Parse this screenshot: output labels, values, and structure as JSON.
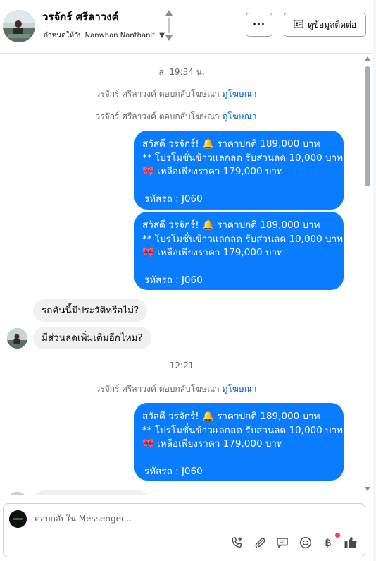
{
  "header": {
    "contact_name": "วรจักร์ ศรีลาวงค์",
    "assignment_text": "กำหนดให้กับ Nanwhan Nanthanit",
    "more_label": "···",
    "contact_info_label": "ดูข้อมูลติดต่อ"
  },
  "messages": {
    "timestamp_1": "ส. 19:34 น.",
    "timestamp_2": "12:21",
    "ad_reply_text": "วรจักร์ ศรีลาวงค์ ตอบกลับโฆษณา",
    "ad_link_text": "ดูโฆษณา",
    "promo": {
      "line1": "สวัสดี วรจักร์! 🔔 ราคาปกติ 189,000 บาท",
      "line2": "** โปรโมชั่นข้าวแลกลด รับส่วนลด 10,000 บาท",
      "line3": "🎀  เหลือเพียงราคา 179,000 บาท",
      "line4": "รหัสรถ : J060"
    },
    "incoming_1": "รถคันนี้มีประวัติหรือไม่?",
    "incoming_2": "มีส่วนลดเพิ่มเติมอีกไหม?"
  },
  "composer": {
    "placeholder": "ตอบกลับใน Messenger...",
    "icons": [
      "phone-add-icon",
      "paperclip-icon",
      "saved-reply-icon",
      "emoji-icon",
      "baht-icon",
      "thumbs-up-icon"
    ],
    "baht_symbol": "฿"
  },
  "colors": {
    "outgoing_bubble": "#0a7cff",
    "incoming_bubble": "#f0f0f0",
    "link": "#0064d1",
    "notification_dot": "#ff3b5c"
  }
}
